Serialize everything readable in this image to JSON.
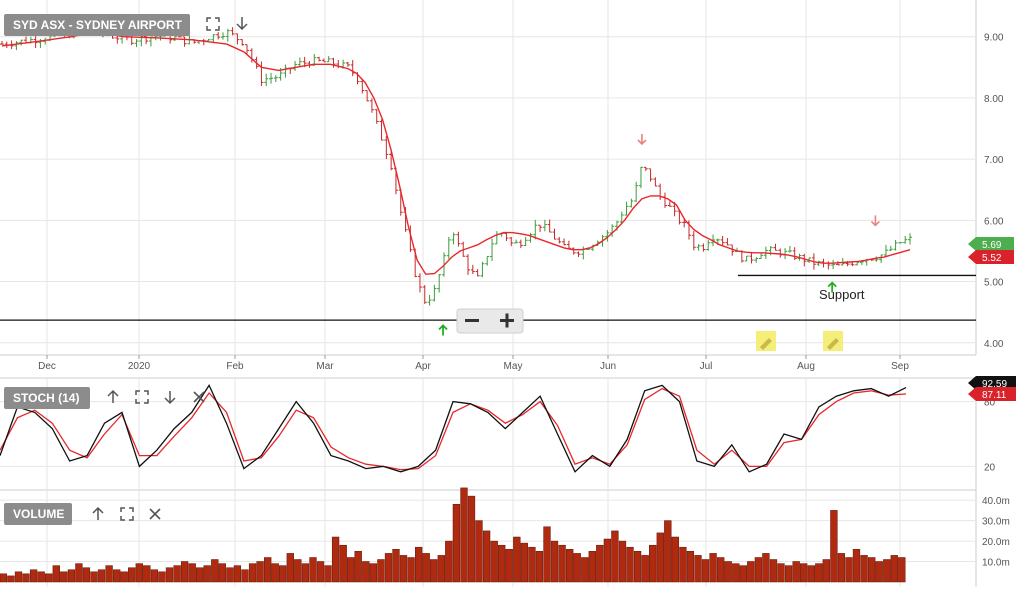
{
  "header": {
    "price_label": "SYD ASX - SYDNEY AIRPORT",
    "stoch_label": "STOCH (14)",
    "volume_label": "VOLUME",
    "support_label": "Support"
  },
  "icons": [
    "fullscreen-icon",
    "arrow-down-icon",
    "arrow-up-icon",
    "close-icon",
    "zoom-out-icon",
    "zoom-in-icon",
    "pencil-icon"
  ],
  "colors": {
    "ma_line": "#e8272d",
    "up_bar": "#3b9c3b",
    "down_bar": "#c62828",
    "stoch_k": "#111111",
    "stoch_d": "#e8272d",
    "volume": "#b02a10",
    "last_price_badge": "#4cae4c",
    "ma_badge": "#d9222a"
  },
  "chart_data": [
    {
      "type": "candlestick",
      "title": "SYD ASX - SYDNEY AIRPORT",
      "x_ticks": [
        "Dec",
        "2020",
        "Feb",
        "Mar",
        "Apr",
        "May",
        "Jun",
        "Jul",
        "Aug",
        "Sep"
      ],
      "y_ticks": [
        "4.00",
        "5.00",
        "6.00",
        "7.00",
        "8.00",
        "9.00"
      ],
      "ylim": [
        3.8,
        9.6
      ],
      "last_price": "5.69",
      "ma_value": "5.52",
      "support_level": 5.1,
      "lower_line": 4.37,
      "price_path": [
        [
          0,
          8.88
        ],
        [
          2,
          8.92
        ],
        [
          5,
          8.98
        ],
        [
          8,
          9.05
        ],
        [
          11,
          9.1
        ],
        [
          13,
          9.0
        ],
        [
          15,
          8.95
        ],
        [
          18,
          9.02
        ],
        [
          20,
          8.98
        ],
        [
          22,
          8.9
        ],
        [
          24,
          9.0
        ],
        [
          26,
          9.08
        ],
        [
          28,
          8.9
        ],
        [
          30,
          8.3
        ],
        [
          32,
          8.35
        ],
        [
          34,
          8.55
        ],
        [
          36,
          8.6
        ],
        [
          38,
          8.58
        ],
        [
          40,
          8.5
        ],
        [
          41,
          8.35
        ],
        [
          42,
          8.05
        ],
        [
          43,
          7.7
        ],
        [
          44,
          7.3
        ],
        [
          45,
          6.9
        ],
        [
          46,
          6.2
        ],
        [
          47,
          5.6
        ],
        [
          48,
          5.0
        ],
        [
          49,
          4.65
        ],
        [
          50,
          4.85
        ],
        [
          51,
          5.3
        ],
        [
          52,
          5.9
        ],
        [
          53,
          5.5
        ],
        [
          54,
          5.2
        ],
        [
          55,
          5.05
        ],
        [
          56,
          5.4
        ],
        [
          57,
          5.75
        ],
        [
          58,
          5.8
        ],
        [
          59,
          5.6
        ],
        [
          60,
          5.65
        ],
        [
          61,
          5.8
        ],
        [
          62,
          5.95
        ],
        [
          63,
          5.85
        ],
        [
          64,
          5.7
        ],
        [
          65,
          5.55
        ],
        [
          66,
          5.5
        ],
        [
          67,
          5.5
        ],
        [
          68,
          5.6
        ],
        [
          69,
          5.7
        ],
        [
          70,
          5.8
        ],
        [
          71,
          5.95
        ],
        [
          72,
          6.2
        ],
        [
          73,
          6.35
        ],
        [
          74,
          6.9
        ],
        [
          75,
          6.7
        ],
        [
          76,
          6.4
        ],
        [
          77,
          6.25
        ],
        [
          78,
          6.05
        ],
        [
          79,
          5.9
        ],
        [
          80,
          5.6
        ],
        [
          81,
          5.55
        ],
        [
          82,
          5.75
        ],
        [
          83,
          5.7
        ],
        [
          84,
          5.6
        ],
        [
          85,
          5.45
        ],
        [
          86,
          5.35
        ],
        [
          87,
          5.4
        ],
        [
          88,
          5.5
        ],
        [
          89,
          5.5
        ],
        [
          90,
          5.48
        ],
        [
          91,
          5.45
        ],
        [
          92,
          5.4
        ],
        [
          93,
          5.35
        ],
        [
          94,
          5.3
        ],
        [
          95,
          5.28
        ],
        [
          96,
          5.25
        ],
        [
          97,
          5.25
        ],
        [
          98,
          5.3
        ],
        [
          99,
          5.35
        ],
        [
          100,
          5.38
        ],
        [
          101,
          5.4
        ],
        [
          102,
          5.45
        ],
        [
          103,
          5.55
        ],
        [
          104,
          5.65
        ],
        [
          105,
          5.69
        ]
      ],
      "ma_path": [
        [
          0,
          8.85
        ],
        [
          4,
          8.92
        ],
        [
          8,
          9.0
        ],
        [
          11,
          9.08
        ],
        [
          14,
          9.0
        ],
        [
          18,
          8.98
        ],
        [
          22,
          8.95
        ],
        [
          26,
          8.88
        ],
        [
          28,
          8.75
        ],
        [
          30,
          8.5
        ],
        [
          32,
          8.45
        ],
        [
          34,
          8.5
        ],
        [
          36,
          8.55
        ],
        [
          38,
          8.55
        ],
        [
          40,
          8.48
        ],
        [
          41,
          8.4
        ],
        [
          42,
          8.25
        ],
        [
          43,
          8.0
        ],
        [
          44,
          7.65
        ],
        [
          45,
          7.15
        ],
        [
          46,
          6.55
        ],
        [
          47,
          5.9
        ],
        [
          48,
          5.35
        ],
        [
          49,
          5.12
        ],
        [
          50,
          5.13
        ],
        [
          51,
          5.25
        ],
        [
          52,
          5.4
        ],
        [
          53,
          5.5
        ],
        [
          54,
          5.55
        ],
        [
          55,
          5.6
        ],
        [
          56,
          5.68
        ],
        [
          57,
          5.75
        ],
        [
          58,
          5.8
        ],
        [
          59,
          5.8
        ],
        [
          60,
          5.78
        ],
        [
          61,
          5.75
        ],
        [
          62,
          5.7
        ],
        [
          63,
          5.65
        ],
        [
          64,
          5.6
        ],
        [
          65,
          5.55
        ],
        [
          66,
          5.52
        ],
        [
          67,
          5.52
        ],
        [
          68,
          5.55
        ],
        [
          69,
          5.62
        ],
        [
          70,
          5.72
        ],
        [
          71,
          5.85
        ],
        [
          72,
          6.0
        ],
        [
          73,
          6.2
        ],
        [
          74,
          6.35
        ],
        [
          75,
          6.4
        ],
        [
          76,
          6.4
        ],
        [
          77,
          6.35
        ],
        [
          78,
          6.25
        ],
        [
          79,
          6.0
        ],
        [
          80,
          5.85
        ],
        [
          81,
          5.75
        ],
        [
          82,
          5.68
        ],
        [
          83,
          5.6
        ],
        [
          84,
          5.55
        ],
        [
          85,
          5.5
        ],
        [
          86,
          5.48
        ],
        [
          87,
          5.47
        ],
        [
          88,
          5.47
        ],
        [
          89,
          5.46
        ],
        [
          90,
          5.45
        ],
        [
          91,
          5.43
        ],
        [
          92,
          5.4
        ],
        [
          93,
          5.36
        ],
        [
          94,
          5.32
        ],
        [
          95,
          5.3
        ],
        [
          96,
          5.3
        ],
        [
          97,
          5.31
        ],
        [
          98,
          5.32
        ],
        [
          99,
          5.33
        ],
        [
          100,
          5.35
        ],
        [
          101,
          5.38
        ],
        [
          102,
          5.4
        ],
        [
          103,
          5.44
        ],
        [
          104,
          5.48
        ],
        [
          105,
          5.52
        ]
      ],
      "sell_markers": [
        [
          74,
          7.28
        ],
        [
          101,
          5.95
        ]
      ],
      "buy_markers": [
        [
          51,
          4.25
        ],
        [
          96,
          4.95
        ]
      ]
    },
    {
      "type": "line",
      "title": "STOCH (14)",
      "y_ticks": [
        "20",
        "80"
      ],
      "ylim": [
        0,
        100
      ],
      "k_value": "92.59",
      "d_value": "87.11",
      "series": [
        {
          "name": "K",
          "values": [
            30,
            75,
            70,
            55,
            25,
            30,
            60,
            70,
            20,
            35,
            55,
            70,
            95,
            60,
            18,
            30,
            55,
            80,
            60,
            30,
            25,
            18,
            20,
            15,
            20,
            35,
            80,
            78,
            70,
            55,
            70,
            85,
            50,
            15,
            30,
            20,
            45,
            90,
            95,
            80,
            25,
            20,
            40,
            15,
            22,
            50,
            45,
            75,
            85,
            90,
            92,
            85,
            93
          ]
        },
        {
          "name": "D",
          "values": [
            35,
            65,
            72,
            60,
            35,
            28,
            50,
            68,
            30,
            30,
            48,
            65,
            88,
            70,
            25,
            28,
            48,
            72,
            65,
            38,
            28,
            22,
            20,
            17,
            18,
            30,
            70,
            78,
            72,
            60,
            68,
            80,
            58,
            22,
            28,
            22,
            40,
            82,
            92,
            85,
            35,
            22,
            35,
            20,
            20,
            42,
            45,
            68,
            80,
            88,
            90,
            86,
            87
          ]
        }
      ]
    },
    {
      "type": "bar",
      "title": "VOLUME",
      "y_ticks": [
        "10.0m",
        "20.0m",
        "30.0m",
        "40.0m"
      ],
      "ylim": [
        0,
        44
      ],
      "values": [
        4,
        3,
        5,
        4,
        6,
        5,
        4,
        8,
        5,
        6,
        9,
        7,
        5,
        6,
        8,
        6,
        5,
        7,
        9,
        8,
        6,
        5,
        7,
        8,
        10,
        9,
        7,
        8,
        11,
        9,
        7,
        8,
        6,
        9,
        10,
        12,
        9,
        8,
        14,
        11,
        9,
        12,
        10,
        8,
        22,
        18,
        12,
        15,
        10,
        9,
        11,
        14,
        16,
        13,
        12,
        17,
        14,
        11,
        13,
        20,
        38,
        46,
        42,
        30,
        25,
        20,
        18,
        16,
        22,
        19,
        17,
        15,
        27,
        20,
        18,
        16,
        14,
        12,
        15,
        18,
        21,
        25,
        20,
        17,
        15,
        13,
        18,
        24,
        30,
        22,
        17,
        15,
        13,
        11,
        14,
        12,
        10,
        9,
        8,
        10,
        12,
        14,
        11,
        9,
        8,
        10,
        9,
        8,
        9,
        11,
        35,
        14,
        12,
        16,
        13,
        12,
        10,
        11,
        13,
        12
      ]
    }
  ]
}
